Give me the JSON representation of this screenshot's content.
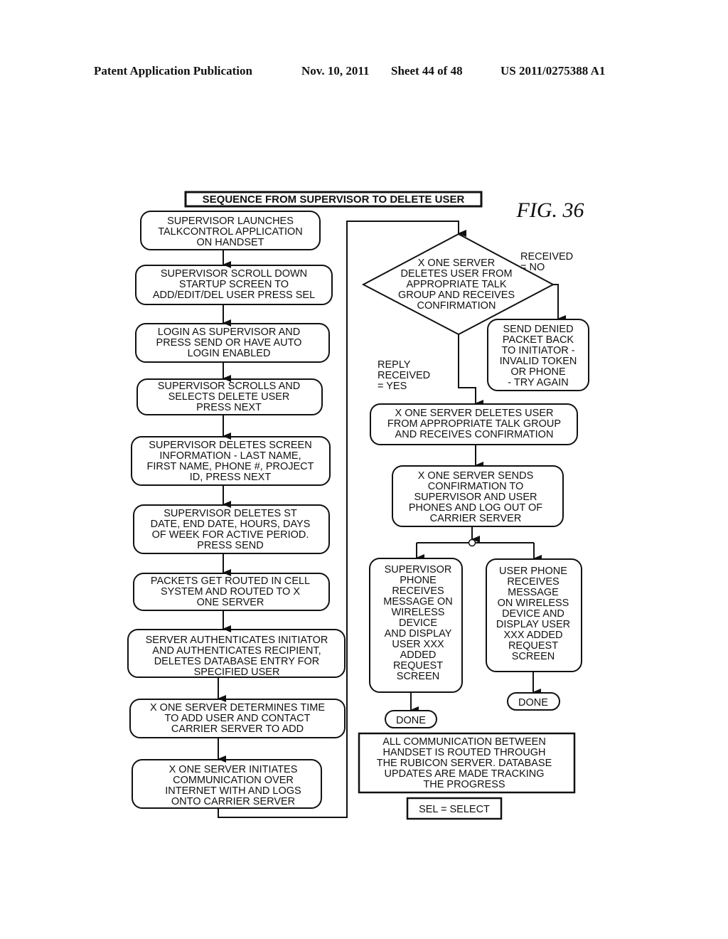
{
  "header": {
    "publication": "Patent Application Publication",
    "date": "Nov. 10, 2011",
    "sheet": "Sheet 44 of 48",
    "number": "US 2011/0275388 A1"
  },
  "figure": {
    "label": "FIG. 36",
    "title": "SEQUENCE FROM SUPERVISOR TO DELETE USER"
  },
  "left_steps": [
    {
      "lines": [
        "SUPERVISOR LAUNCHES",
        "TALKCONTROL APPLICATION",
        "ON HANDSET"
      ]
    },
    {
      "lines": [
        "SUPERVISOR SCROLL DOWN",
        "STARTUP SCREEN TO",
        "ADD/EDIT/DEL USER PRESS SEL"
      ]
    },
    {
      "lines": [
        "LOGIN AS SUPERVISOR AND",
        "PRESS SEND OR HAVE AUTO",
        "LOGIN ENABLED"
      ]
    },
    {
      "lines": [
        "SUPERVISOR SCROLLS AND",
        "SELECTS DELETE USER",
        "PRESS NEXT"
      ]
    },
    {
      "lines": [
        "SUPERVISOR DELETES SCREEN",
        "INFORMATION - LAST NAME,",
        "FIRST NAME, PHONE #, PROJECT",
        "ID, PRESS NEXT"
      ]
    },
    {
      "lines": [
        "SUPERVISOR DELETES ST",
        "DATE, END DATE, HOURS, DAYS",
        "OF WEEK FOR ACTIVE PERIOD.",
        "PRESS SEND"
      ]
    },
    {
      "lines": [
        "PACKETS GET ROUTED IN CELL",
        "SYSTEM AND ROUTED TO X",
        "ONE SERVER"
      ]
    },
    {
      "lines": [
        "SERVER AUTHENTICATES INITIATOR",
        "AND AUTHENTICATES RECIPIENT,",
        "DELETES DATABASE ENTRY FOR",
        "SPECIFIED USER"
      ]
    },
    {
      "lines": [
        "X ONE SERVER DETERMINES TIME",
        "TO ADD USER AND CONTACT",
        "CARRIER SERVER TO ADD"
      ]
    },
    {
      "lines": [
        "X ONE SERVER INITIATES",
        "COMMUNICATION OVER",
        "INTERNET WITH AND LOGS",
        "ONTO CARRIER SERVER"
      ]
    }
  ],
  "decision": {
    "lines": [
      "X ONE SERVER",
      "DELETES USER FROM",
      "APPROPRIATE TALK",
      "GROUP AND RECEIVES",
      "CONFIRMATION"
    ],
    "no_label": [
      "RECEIVED",
      "= NO"
    ],
    "yes_label": [
      "REPLY",
      "RECEIVED",
      "= YES"
    ]
  },
  "denied": {
    "lines": [
      "SEND DENIED",
      "PACKET BACK",
      "TO INITIATOR -",
      "INVALID TOKEN",
      "OR PHONE",
      "- TRY AGAIN"
    ]
  },
  "right_steps": [
    {
      "lines": [
        "X ONE SERVER DELETES USER",
        "FROM APPROPRIATE TALK GROUP",
        "AND RECEIVES CONFIRMATION"
      ]
    },
    {
      "lines": [
        "X ONE SERVER SENDS",
        "CONFIRMATION TO",
        "SUPERVISOR AND USER",
        "PHONES AND LOG OUT OF",
        "CARRIER SERVER"
      ]
    }
  ],
  "supervisor_phone": {
    "lines": [
      "SUPERVISOR",
      "PHONE",
      "RECEIVES",
      "MESSAGE ON",
      "WIRELESS",
      "DEVICE",
      "AND DISPLAY",
      "USER XXX",
      "ADDED",
      "REQUEST",
      "SCREEN"
    ]
  },
  "user_phone": {
    "lines": [
      "USER PHONE",
      "RECEIVES",
      "MESSAGE",
      "ON WIRELESS",
      "DEVICE AND",
      "DISPLAY USER",
      "XXX ADDED",
      "REQUEST",
      "SCREEN"
    ]
  },
  "terminals": {
    "left": "DONE",
    "right": "DONE"
  },
  "note": {
    "lines": [
      "ALL COMMUNICATION BETWEEN",
      "HANDSET IS ROUTED THROUGH",
      "THE RUBICON SERVER.  DATABASE",
      "UPDATES ARE MADE TRACKING",
      "THE PROGRESS"
    ]
  },
  "legend": "SEL = SELECT"
}
